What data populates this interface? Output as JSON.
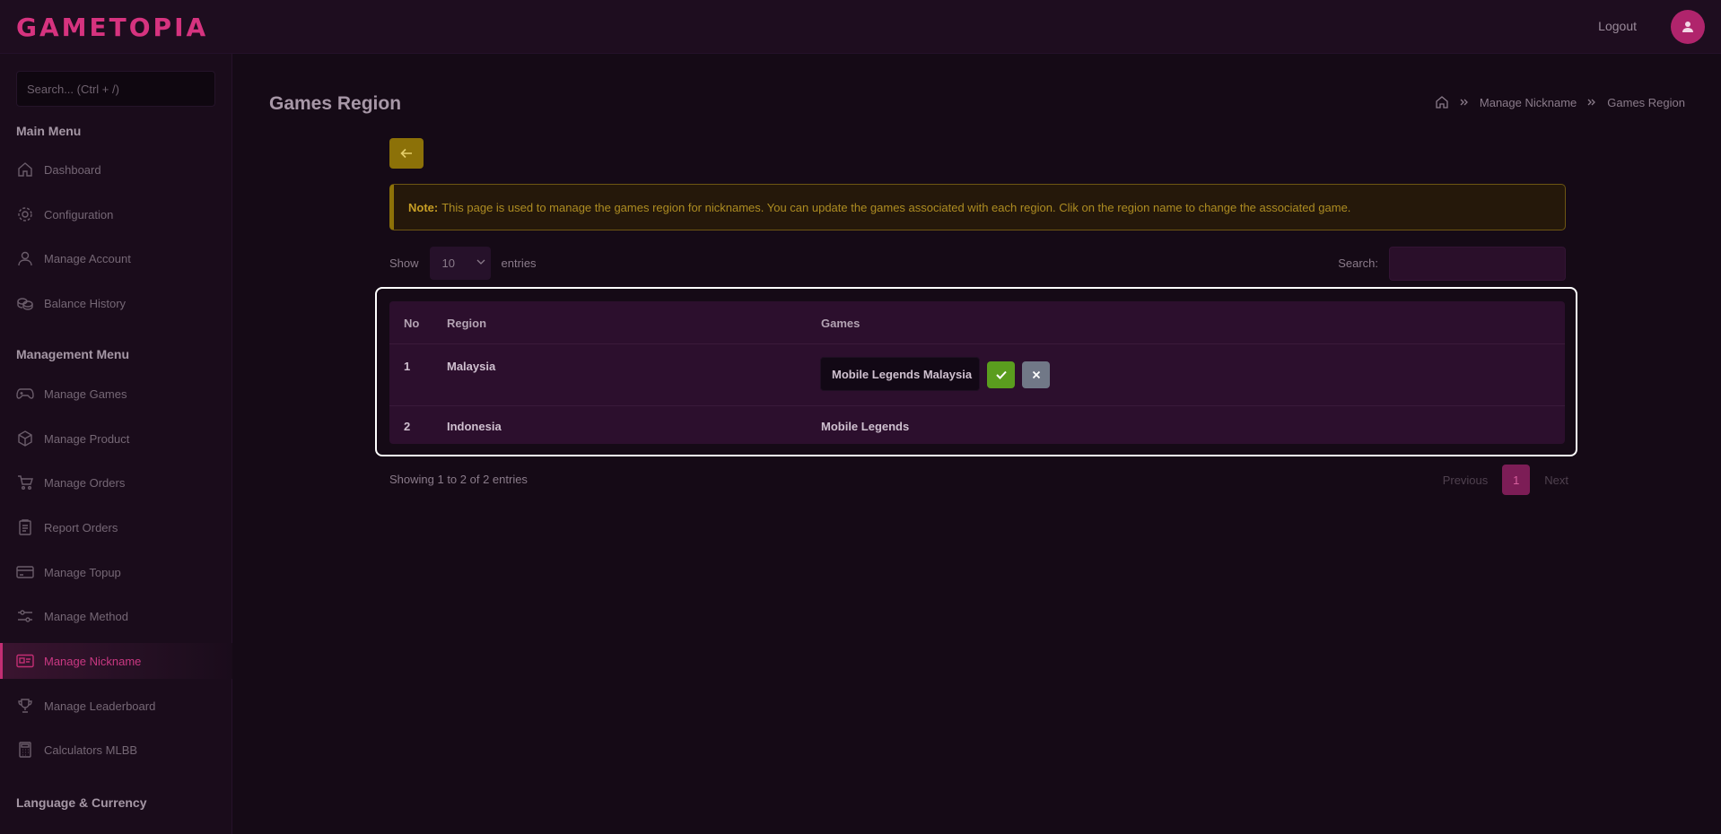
{
  "app": {
    "logo_text": "GAMETOPIA",
    "logout_label": "Logout",
    "brand_color": "#d6337f"
  },
  "sidebar": {
    "search_placeholder": "Search... (Ctrl + /)",
    "main_menu_heading": "Main Menu",
    "main_items": [
      {
        "label": "Dashboard",
        "icon": "home-icon"
      },
      {
        "label": "Configuration",
        "icon": "gear-icon"
      },
      {
        "label": "Manage Account",
        "icon": "user-icon"
      },
      {
        "label": "Balance History",
        "icon": "coins-icon"
      }
    ],
    "management_menu_heading": "Management Menu",
    "management_items": [
      {
        "label": "Manage Games",
        "icon": "gamepad-icon"
      },
      {
        "label": "Manage Product",
        "icon": "box-icon"
      },
      {
        "label": "Manage Orders",
        "icon": "cart-icon"
      },
      {
        "label": "Report Orders",
        "icon": "clipboard-icon"
      },
      {
        "label": "Manage Topup",
        "icon": "card-icon"
      },
      {
        "label": "Manage Method",
        "icon": "sliders-icon"
      },
      {
        "label": "Manage Nickname",
        "icon": "id-card-icon",
        "active": true
      },
      {
        "label": "Manage Leaderboard",
        "icon": "trophy-icon"
      },
      {
        "label": "Calculators MLBB",
        "icon": "calculator-icon"
      }
    ],
    "language_heading": "Language & Currency"
  },
  "main": {
    "page_title": "Games Region",
    "breadcrumb": {
      "home_icon": "home-icon",
      "items": [
        "Manage Nickname",
        "Games Region"
      ]
    },
    "note": {
      "label": "Note:",
      "text": "This page is used to manage the games region for nicknames. You can update the games associated with each region. Clik on the region name to change the associated game."
    },
    "table_controls": {
      "show_label": "Show",
      "entries_value": "10",
      "entries_label": "entries",
      "search_label": "Search:"
    },
    "table": {
      "headers": [
        "No",
        "Region",
        "Games"
      ],
      "rows": [
        {
          "no": "1",
          "region": "Malaysia",
          "games": "Mobile Legends Malaysia",
          "editing": true
        },
        {
          "no": "2",
          "region": "Indonesia",
          "games": "Mobile Legends",
          "editing": false
        }
      ]
    },
    "footer": {
      "showing_text": "Showing 1 to 2 of 2 entries",
      "prev_label": "Previous",
      "current_page": "1",
      "next_label": "Next"
    }
  }
}
